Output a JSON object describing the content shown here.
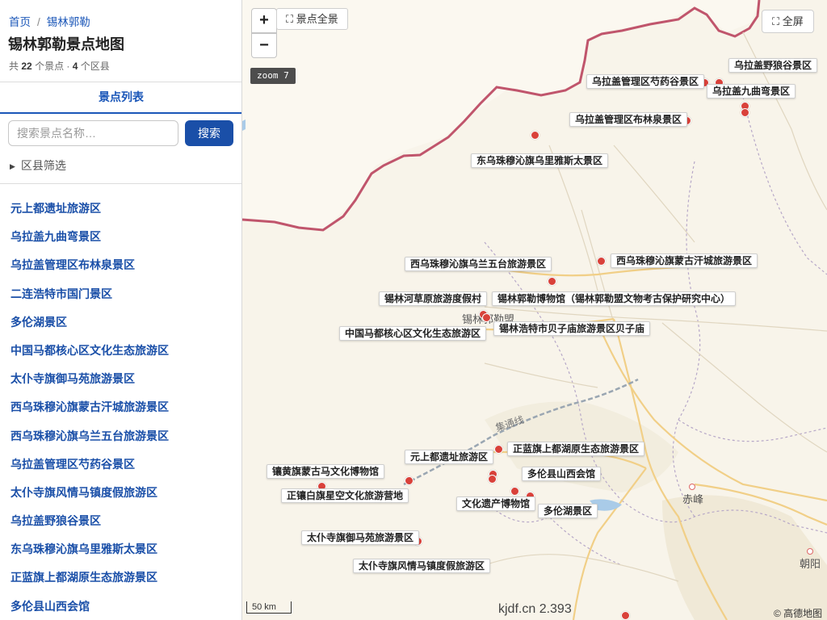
{
  "breadcrumb": {
    "home": "首页",
    "separator": "/",
    "current": "锡林郭勒"
  },
  "page_title": "锡林郭勒景点地图",
  "summary": {
    "prefix": "共",
    "spot_count": "22",
    "spot_unit": "个景点 ·",
    "district_count": "4",
    "district_unit": "个区县"
  },
  "tabs": {
    "list_label": "景点列表"
  },
  "search": {
    "placeholder": "搜索景点名称…",
    "button_label": "搜索"
  },
  "filter": {
    "label": "区县筛选"
  },
  "spot_list": [
    "元上都遗址旅游区",
    "乌拉盖九曲弯景区",
    "乌拉盖管理区布林泉景区",
    "二连浩特市国门景区",
    "多伦湖景区",
    "中国马都核心区文化生态旅游区",
    "太仆寺旗御马苑旅游景区",
    "西乌珠穆沁旗蒙古汗城旅游景区",
    "西乌珠穆沁旗乌兰五台旅游景区",
    "乌拉盖管理区芍药谷景区",
    "太仆寺旗风情马镇度假旅游区",
    "乌拉盖野狼谷景区",
    "东乌珠穆沁旗乌里雅斯太景区",
    "正蓝旗上都湖原生态旅游景区",
    "多伦县山西会馆"
  ],
  "map": {
    "controls": {
      "zoom_in": "+",
      "zoom_out": "−",
      "show_all": "景点全景",
      "fullscreen": "全屏",
      "zoom_level": "zoom 7"
    },
    "labels": [
      "乌拉盖野狼谷景区",
      "乌拉盖管理区芍药谷景区",
      "乌拉盖九曲弯景区",
      "乌拉盖管理区布林泉景区",
      "东乌珠穆沁旗乌里雅斯太景区",
      "西乌珠穆沁旗乌兰五台旅游景区",
      "西乌珠穆沁旗蒙古汗城旅游景区",
      "锡林河草原旅游度假村",
      "锡林郭勒博物馆（锡林郭勒盟文物考古保护研究中心）",
      "中国马都核心区文化生态旅游区",
      "锡林浩特市贝子庙旅游景区贝子庙",
      "正蓝旗上都湖原生态旅游景区",
      "元上都遗址旅游区",
      "多伦县山西会馆",
      "镶黄旗蒙古马文化博物馆",
      "正镶白旗星空文化旅游营地",
      "文化遗产博物馆",
      "多伦湖景区",
      "太仆寺旗御马苑旅游景区",
      "太仆寺旗风情马镇度假旅游区"
    ],
    "cities": {
      "xilin": "锡林郭勒盟",
      "chifeng": "赤峰",
      "chaoyang": "朝阳"
    },
    "road_label": "集通线",
    "scale": "50 km",
    "watermark": "kjdf.cn 2.393",
    "attribution": "© 高德地图",
    "colors": {
      "marker": "#d9413a",
      "border": "#c0556c",
      "link": "#1a4fa8"
    }
  }
}
